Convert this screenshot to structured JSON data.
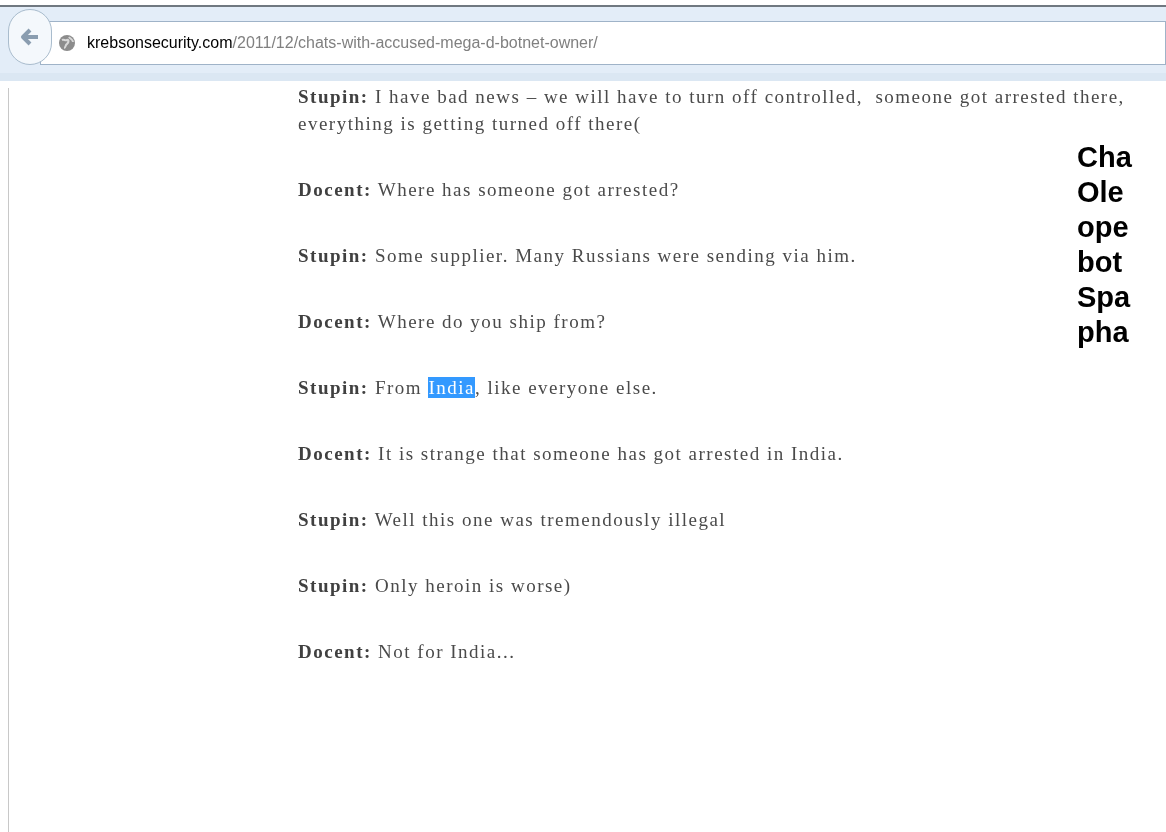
{
  "address_bar": {
    "domain": "krebsonsecurity.com",
    "path": "/2011/12/chats-with-accused-mega-d-botnet-owner/"
  },
  "messages": [
    {
      "speaker": "Stupin:",
      "segments": [
        {
          "text": "I have bad news – we will have to turn off controlled,  someone got arrested there, everything is getting turned off there(",
          "selected": false
        }
      ]
    },
    {
      "speaker": "Docent:",
      "segments": [
        {
          "text": "Where has someone got arrested?",
          "selected": false
        }
      ]
    },
    {
      "speaker": "Stupin:",
      "segments": [
        {
          "text": "Some supplier. Many Russians were sending via him.",
          "selected": false
        }
      ]
    },
    {
      "speaker": "Docent:",
      "segments": [
        {
          "text": "Where do you ship from?",
          "selected": false
        }
      ]
    },
    {
      "speaker": "Stupin:",
      "segments": [
        {
          "text": "From ",
          "selected": false
        },
        {
          "text": "India",
          "selected": true
        },
        {
          "text": ", like everyone else.",
          "selected": false
        }
      ]
    },
    {
      "speaker": "Docent:",
      "segments": [
        {
          "text": "It is strange that someone has got arrested in India.",
          "selected": false
        }
      ]
    },
    {
      "speaker": "Stupin:",
      "segments": [
        {
          "text": "Well this one was tremendously illegal",
          "selected": false
        }
      ]
    },
    {
      "speaker": "Stupin:",
      "segments": [
        {
          "text": "Only heroin is worse)",
          "selected": false
        }
      ]
    },
    {
      "speaker": "Docent:",
      "segments": [
        {
          "text": "Not for India...",
          "selected": false
        }
      ]
    }
  ],
  "overlay_caption": [
    "Cha",
    "Ole",
    "ope",
    "bot",
    "Spa",
    "pha"
  ]
}
